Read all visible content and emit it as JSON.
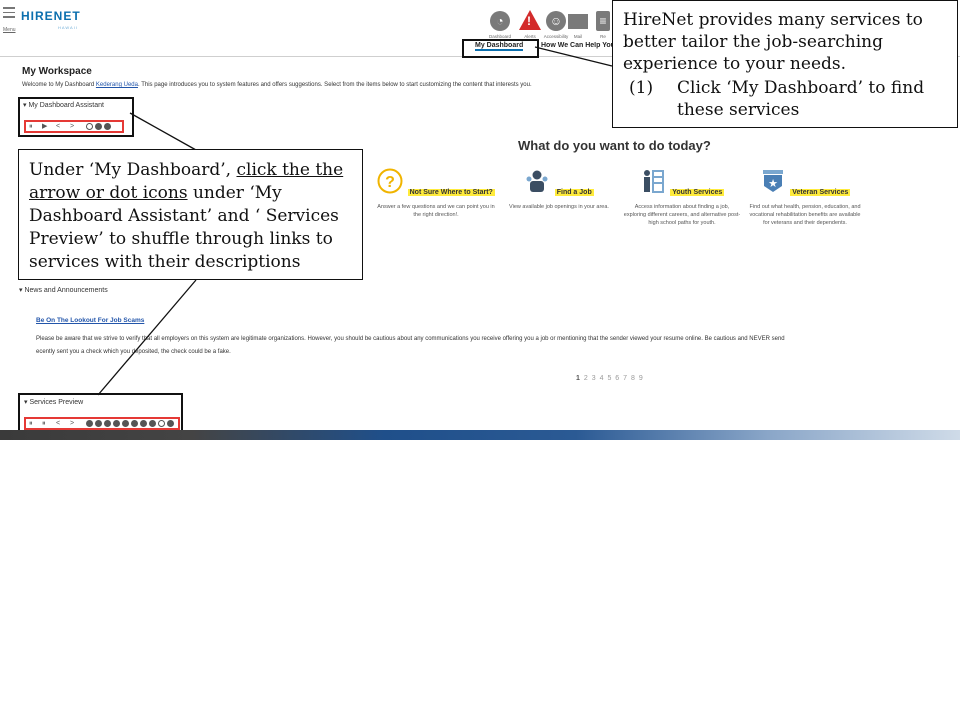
{
  "header": {
    "menu_label": "Menu",
    "logo": "HIRENET",
    "logo_sub": "HAWAII",
    "icons": [
      {
        "name": "dashboard-icon",
        "label": "Dashboard"
      },
      {
        "name": "alert-icon",
        "label": "Alerts"
      },
      {
        "name": "accessibility-icon",
        "label": "Accessibility"
      },
      {
        "name": "mail-icon",
        "label": "Mail"
      },
      {
        "name": "resume-icon",
        "label": "Re"
      }
    ],
    "tabs": [
      "My Dashboard",
      "How We Can Help You"
    ]
  },
  "workspace": {
    "title": "My Workspace",
    "desc_before": "Welcome to My Dashboard ",
    "user_link": "Kederang Ueda",
    "desc_after": ". This page introduces you to system features and offers suggestions. Select from the items below to start customizing the content that interests you."
  },
  "assistant": {
    "heading": "My Dashboard Assistant",
    "controls": [
      "⏸",
      "▶",
      "<",
      ">"
    ]
  },
  "prompt": "What do you want to do today?",
  "services": [
    {
      "icon": "question-icon",
      "name": "Not Sure Where to Start?",
      "desc": "Answer a few questions and we can point you in the right direction!."
    },
    {
      "icon": "job-seeker-icon",
      "name": "Find a Job",
      "desc": "View available job openings in your area."
    },
    {
      "icon": "youth-icon",
      "name": "Youth Services",
      "desc": "Access information about finding a job, exploring different careers, and alternative post-high school paths for youth."
    },
    {
      "icon": "veteran-icon",
      "name": "Veteran Services",
      "desc": "Find out what health, pension, education, and vocational rehabilitation benefits are available for veterans and their dependents."
    }
  ],
  "news": {
    "heading": "News and Announcements",
    "link": "Be On The Lookout For Job Scams",
    "body_line1": "Please be aware that we strive to verify that all employers on this system are legitimate organizations. However, you should be cautious about any communications you receive offering you a job or mentioning that the sender viewed your resume online. Be cautious and NEVER send",
    "body_line2": "recently sent you a check which you deposited, the check could be a fake.",
    "pager": [
      "1",
      "2",
      "3",
      "4",
      "5",
      "6",
      "7",
      "8",
      "9"
    ]
  },
  "services_preview": {
    "heading": "Services Preview",
    "controls": [
      "⏸",
      "⏸",
      "<",
      ">"
    ]
  },
  "callouts": {
    "top_intro": "HireNet provides many services to better tailor the job-searching experience to your needs.",
    "top_step_num": "(1)",
    "top_step_text": "Click ‘My Dashboard’ to find these services",
    "left_before": "Under ‘My Dashboard’, ",
    "left_underlined": "click the the arrow or dot icons",
    "left_after": " under ‘My Dashboard Assistant’ and ‘ Services Preview’ to shuffle through links to services with their descriptions"
  },
  "colors": {
    "brand": "#0b6fae",
    "alert": "#d32b2b",
    "highlight": "#ffeb3b",
    "control_box": "#e53935"
  }
}
